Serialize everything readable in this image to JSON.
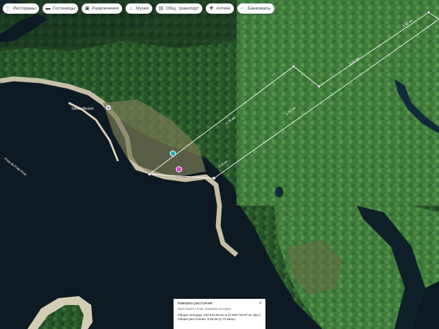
{
  "toolbar": {
    "chips": [
      {
        "id": "restaurants",
        "label": "Рестораны",
        "icon": "fork-knife-icon",
        "glyph": "🍴"
      },
      {
        "id": "hotels",
        "label": "Гостиницы",
        "icon": "bed-icon",
        "glyph": "▬"
      },
      {
        "id": "entertainment",
        "label": "Развлечения",
        "icon": "ticket-icon",
        "glyph": "▣"
      },
      {
        "id": "museums",
        "label": "Музеи",
        "icon": "museum-icon",
        "glyph": "⌂"
      },
      {
        "id": "transport",
        "label": "Общ. транспорт",
        "icon": "transit-icon",
        "glyph": "▤"
      },
      {
        "id": "pharmacies",
        "label": "Аптеки",
        "icon": "pharmacy-icon",
        "glyph": "✚"
      },
      {
        "id": "atm",
        "label": "Банкоматы",
        "icon": "more-icon",
        "glyph": "⋯"
      }
    ]
  },
  "map_labels": {
    "place": "Silves Resort",
    "river": "Praia da Frida River",
    "seg1": "0.76 км",
    "seg2": "1.00 км",
    "seg3": "2.56 км",
    "seg4": "0.56 км",
    "seg5": "1.50 км"
  },
  "measure_box": {
    "title": "Измерить расстояние",
    "hint": "Проставьте точки, нажимая на карте",
    "area": "Общая площадь: 233 610,92 кв. м (2 509 723,07 кв. фут.)",
    "distance": "Общее расстояние: 6,56 км (2,73 миль)",
    "close": "✕"
  },
  "colors": {
    "water": "#0d1a23",
    "forest_dark": "#1c3a1f",
    "forest": "#2a5a2b",
    "forest_light": "#3e7a3a",
    "sand": "#c8c0aa",
    "measure_line": "#ffffff",
    "pin_teal": "#19b3b0",
    "pin_pink": "#e040c8"
  }
}
